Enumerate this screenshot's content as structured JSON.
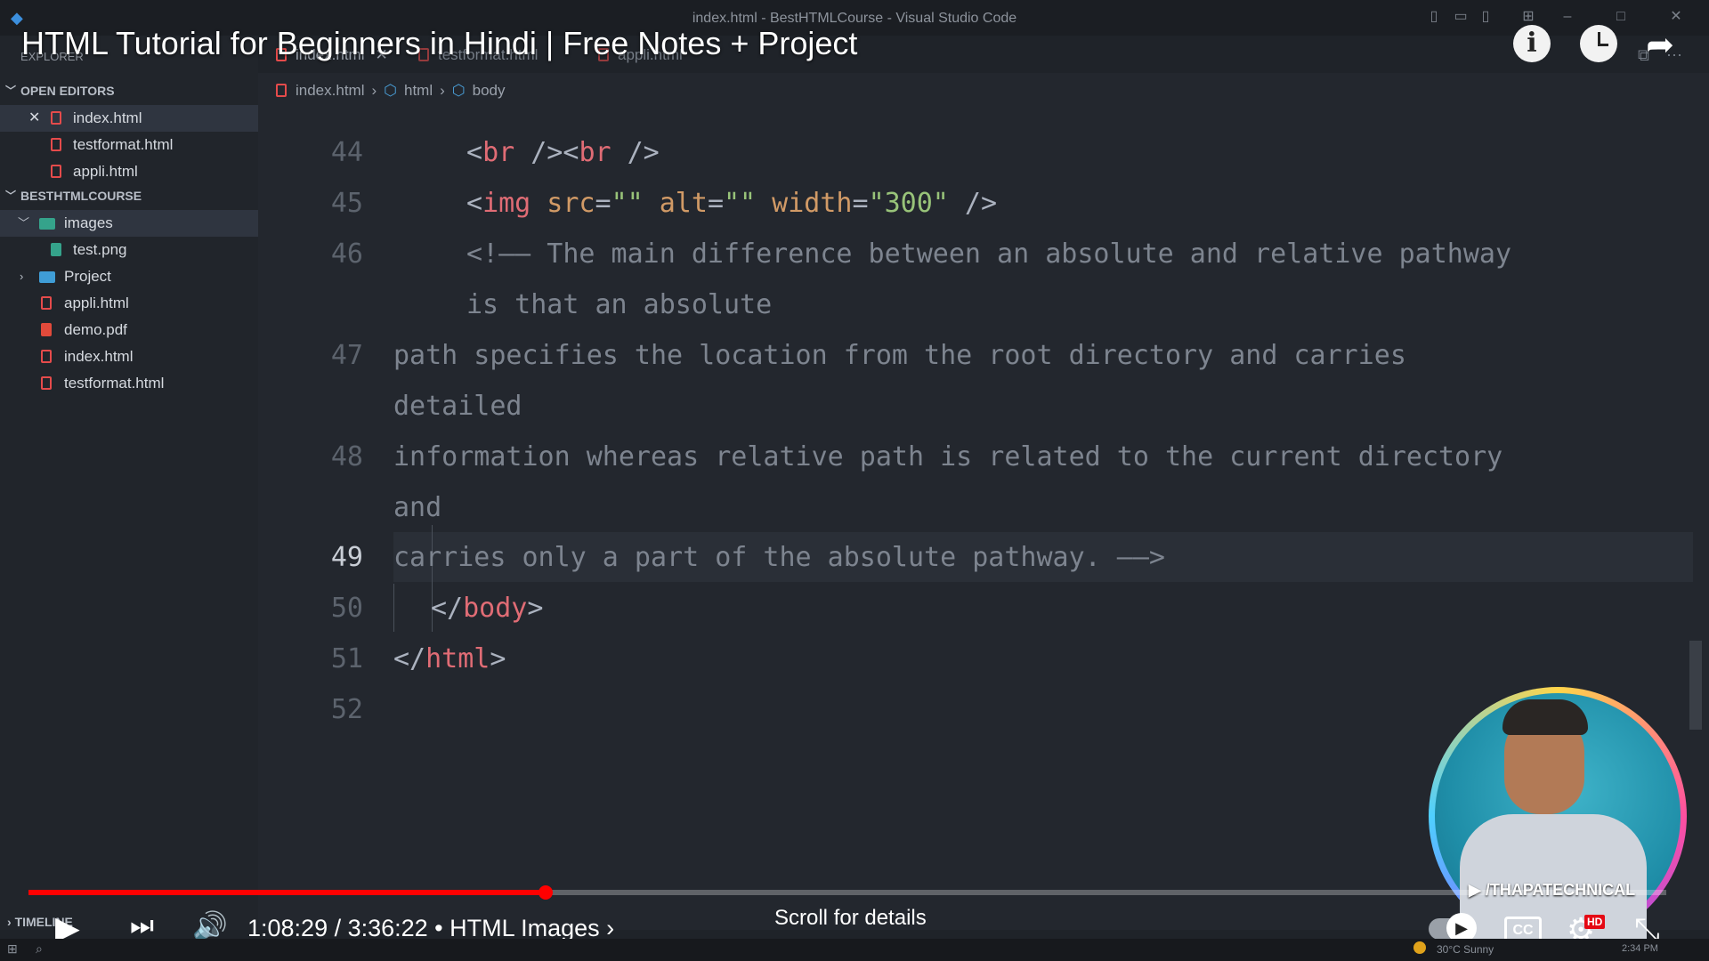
{
  "window": {
    "title": "index.html - BestHTMLCourse - Visual Studio Code"
  },
  "video": {
    "title": "HTML Tutorial for Beginners in Hindi | Free Notes + Project",
    "time": "1:08:29 / 3:36:22 • HTML Images ›",
    "scroll_hint": "Scroll for details",
    "progress_fraction": 0.316,
    "channel": "/THAPATECHNICAL",
    "hd_badge": "HD"
  },
  "sidebar": {
    "explorer_title": "EXPLORER",
    "open_editors_title": "OPEN EDITORS",
    "open_editors": [
      {
        "label": "index.html"
      },
      {
        "label": "testformat.html"
      },
      {
        "label": "appli.html"
      }
    ],
    "project_title": "BESTHTMLCOURSE",
    "tree": [
      {
        "label": "images"
      },
      {
        "label": "test.png"
      },
      {
        "label": "Project"
      },
      {
        "label": "appli.html"
      },
      {
        "label": "demo.pdf"
      },
      {
        "label": "index.html"
      },
      {
        "label": "testformat.html"
      }
    ],
    "timeline_title": "TIMELINE"
  },
  "tabs": [
    "index.html",
    "testformat.html",
    "appli.html"
  ],
  "breadcrumb": [
    "index.html",
    "html",
    "body"
  ],
  "code": {
    "line_numbers": [
      "44",
      "45",
      "46",
      "47",
      "48",
      "49",
      "50",
      "51",
      "52"
    ],
    "l44": {
      "t1": "<",
      "t2": "br",
      "t3": " />",
      "t4": "<",
      "t5": "br",
      "t6": " />"
    },
    "l45": {
      "t1": "<",
      "t2": "img",
      "a1": " src",
      "eq1": "=",
      "s1": "\"\"",
      "a2": " alt",
      "eq2": "=",
      "s2": "\"\"",
      "a3": " width",
      "eq3": "=",
      "s3": "\"300\"",
      "t3": " />"
    },
    "l46a": "<!—— The main difference between an absolute and relative pathway",
    "l46b": "is that an absolute",
    "l47a": "path specifies the location from the root directory and carries",
    "l47b": "detailed",
    "l48a": "information whereas relative path is related to the current directory",
    "l48b": "and",
    "l49": "carries only a part of the absolute pathway. ——>",
    "l50": {
      "t1": "</",
      "t2": "body",
      "t3": ">"
    },
    "l51": {
      "t1": "</",
      "t2": "html",
      "t3": ">"
    }
  },
  "taskbar": {
    "weather": "30°C  Sunny",
    "clock": "2:34 PM"
  }
}
